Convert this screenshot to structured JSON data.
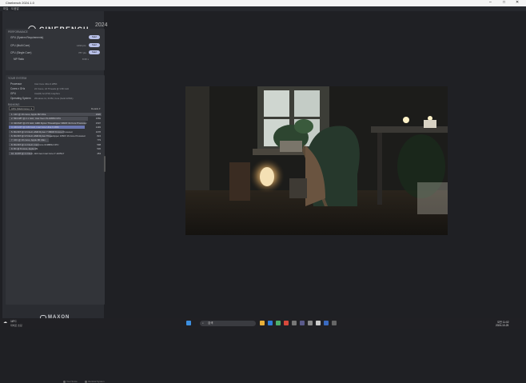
{
  "window": {
    "title": "Cinebench 2024.1.0",
    "min": "–",
    "max": "□",
    "close": "✕"
  },
  "menu": [
    "파일",
    "도움말"
  ],
  "header": {
    "brand": "CINEBENCH",
    "year": "2024"
  },
  "performance": {
    "title": "PERFORMANCE",
    "rows": [
      {
        "label": "GPU (System Requirements)",
        "value": "",
        "button": "Start"
      },
      {
        "label": "CPU (Multi Core)",
        "value": "1493 pts",
        "button": "Start"
      },
      {
        "label": "CPU (Single Core)",
        "value": "787 pts",
        "button": "Start"
      },
      {
        "label": "MP Ratio",
        "value": "8.95 x",
        "button": ""
      }
    ]
  },
  "system": {
    "title": "YOUR SYSTEM",
    "rows": [
      {
        "label": "Processor",
        "value": "Intel Core Ultra 9 285K"
      },
      {
        "label": "Cores x GHz",
        "value": "24 Cores, 24 Threads @ 3.80 GHz"
      },
      {
        "label": "GPU",
        "value": "Intel(R) Arc(TM) Graphics"
      },
      {
        "label": "Operating System",
        "value": "Windows 11, 64 Bit, Core (build 22631)"
      },
      {
        "label": "Info",
        "value": ""
      }
    ]
  },
  "ranking": {
    "title": "RANKING",
    "dropdown": "CPU (Multi Core)",
    "details": "Details ▾",
    "rows": [
      {
        "label": "1. 12C @ 16 cores, Apple M2 Ultra",
        "score": "1820",
        "highlight": false
      },
      {
        "label": "2. 56C/48T @ 2.1 GHz, Intel Xeon W-3265M CPU",
        "score": "1559",
        "highlight": false
      },
      {
        "label": "3. 32C/64T @ 2.5 GHz, AMD Ryzen Threadripper 3990X 32-Core Processor",
        "score": "1507",
        "highlight": false
      },
      {
        "label": "4. 24C/24T @ 3.80 GHz, Intel Core Ultra 9 285K",
        "score": "1493",
        "highlight": true
      },
      {
        "label": "5. 8C/16T @ 3.6 GHz, AMD Ryzen 7 3800X 8-Core Processor",
        "score": "1078",
        "highlight": false
      },
      {
        "label": "6. 8C/16T @ 3.5 GHz, AMD Ryzen Threadripper 1950X 16-Core Processor",
        "score": "824",
        "highlight": false
      },
      {
        "label": "7. 10C @ 10 cores, Apple M1 Max",
        "score": "779",
        "highlight": false
      },
      {
        "label": "8. 8C/16T @ 2.3 GHz, Intel Core i9-9880H CPU",
        "score": "598",
        "highlight": false
      },
      {
        "label": "9. 8C @ 8 cores, Apple M1",
        "score": "530",
        "highlight": false
      },
      {
        "label": "10. 4C/8T @ 2.3 GHz, 11th Gen Intel Core i7-1165G7",
        "score": "453",
        "highlight": false
      }
    ],
    "legend": {
      "your_score": "Your Score",
      "identical": "Identical System"
    }
  },
  "footer_brand": "MAXON",
  "taskbar": {
    "weather_temp": "18°C",
    "weather_desc": "대체로 흐림",
    "search": "검색",
    "clock_time": "오전 11:02",
    "clock_date": "2024-10-25"
  },
  "colors": {
    "accent": "#b8c0e8",
    "highlight": "#6a76b0",
    "sidebar": "#2a2c31",
    "background": "#1f2024"
  },
  "icons": [
    "logo-circle-icon",
    "dropdown-chevron-icon",
    "windows-start-icon",
    "search-icon",
    "weather-icon"
  ]
}
